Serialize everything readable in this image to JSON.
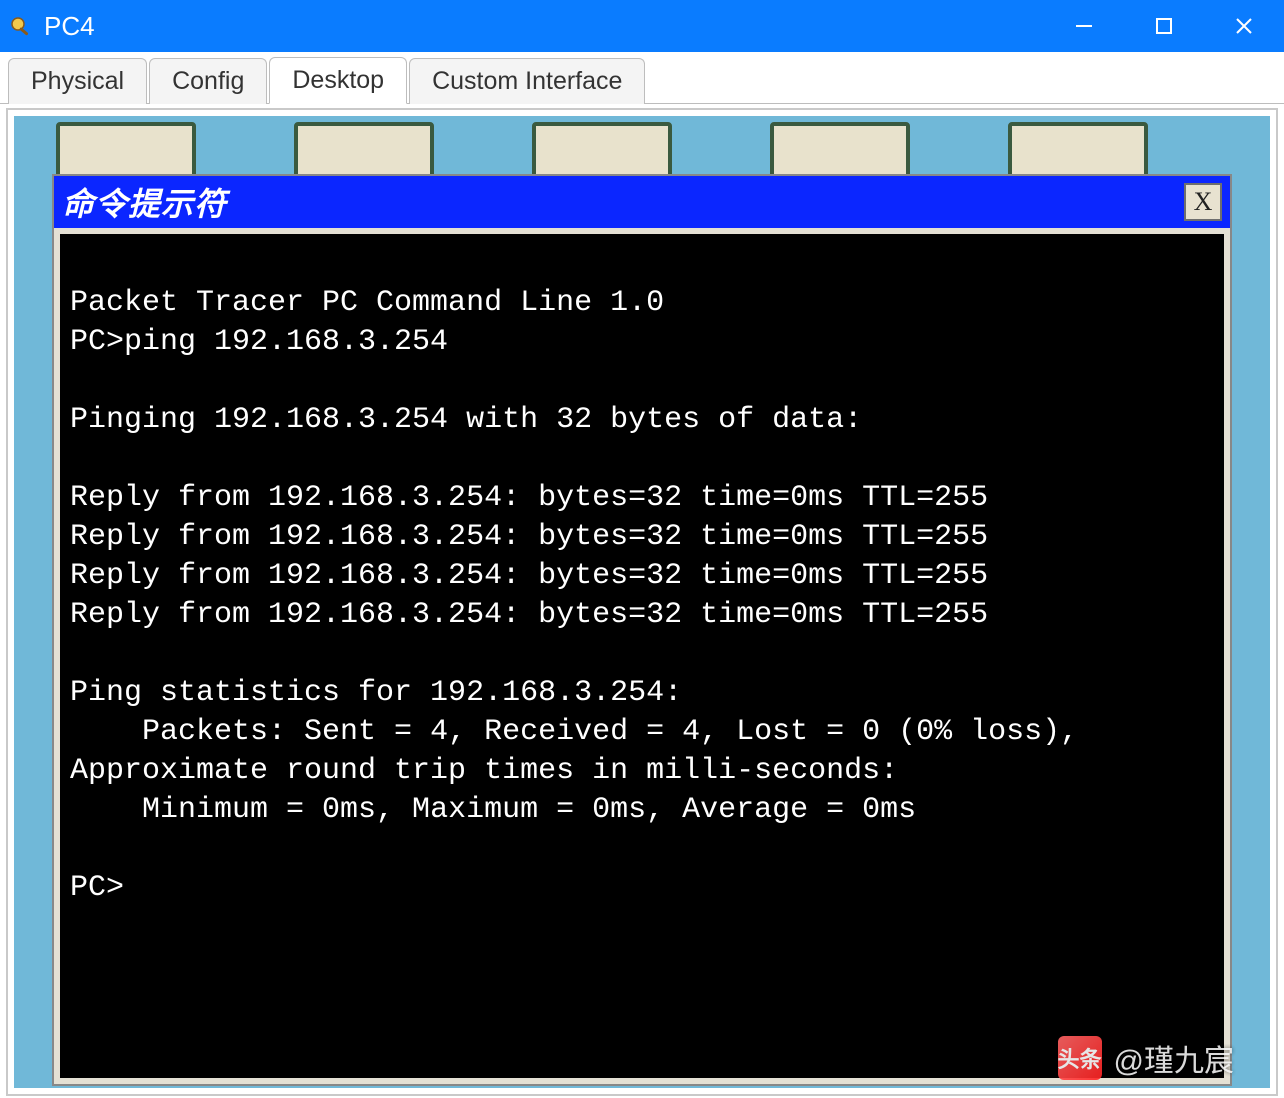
{
  "window": {
    "title": "PC4",
    "minimize": "—",
    "maximize": "☐",
    "close": "✕"
  },
  "tabs": [
    {
      "label": "Physical",
      "active": false
    },
    {
      "label": "Config",
      "active": false
    },
    {
      "label": "Desktop",
      "active": true
    },
    {
      "label": "Custom Interface",
      "active": false
    }
  ],
  "cmd": {
    "title": "命令提示符",
    "close_label": "X"
  },
  "terminal": {
    "lines": [
      "Packet Tracer PC Command Line 1.0",
      "PC>ping 192.168.3.254",
      "",
      "Pinging 192.168.3.254 with 32 bytes of data:",
      "",
      "Reply from 192.168.3.254: bytes=32 time=0ms TTL=255",
      "Reply from 192.168.3.254: bytes=32 time=0ms TTL=255",
      "Reply from 192.168.3.254: bytes=32 time=0ms TTL=255",
      "Reply from 192.168.3.254: bytes=32 time=0ms TTL=255",
      "",
      "Ping statistics for 192.168.3.254:",
      "    Packets: Sent = 4, Received = 4, Lost = 0 (0% loss),",
      "Approximate round trip times in milli-seconds:",
      "    Minimum = 0ms, Maximum = 0ms, Average = 0ms",
      "",
      "PC>"
    ]
  },
  "watermark": {
    "label": "头条",
    "text": "@瑾九宸"
  }
}
